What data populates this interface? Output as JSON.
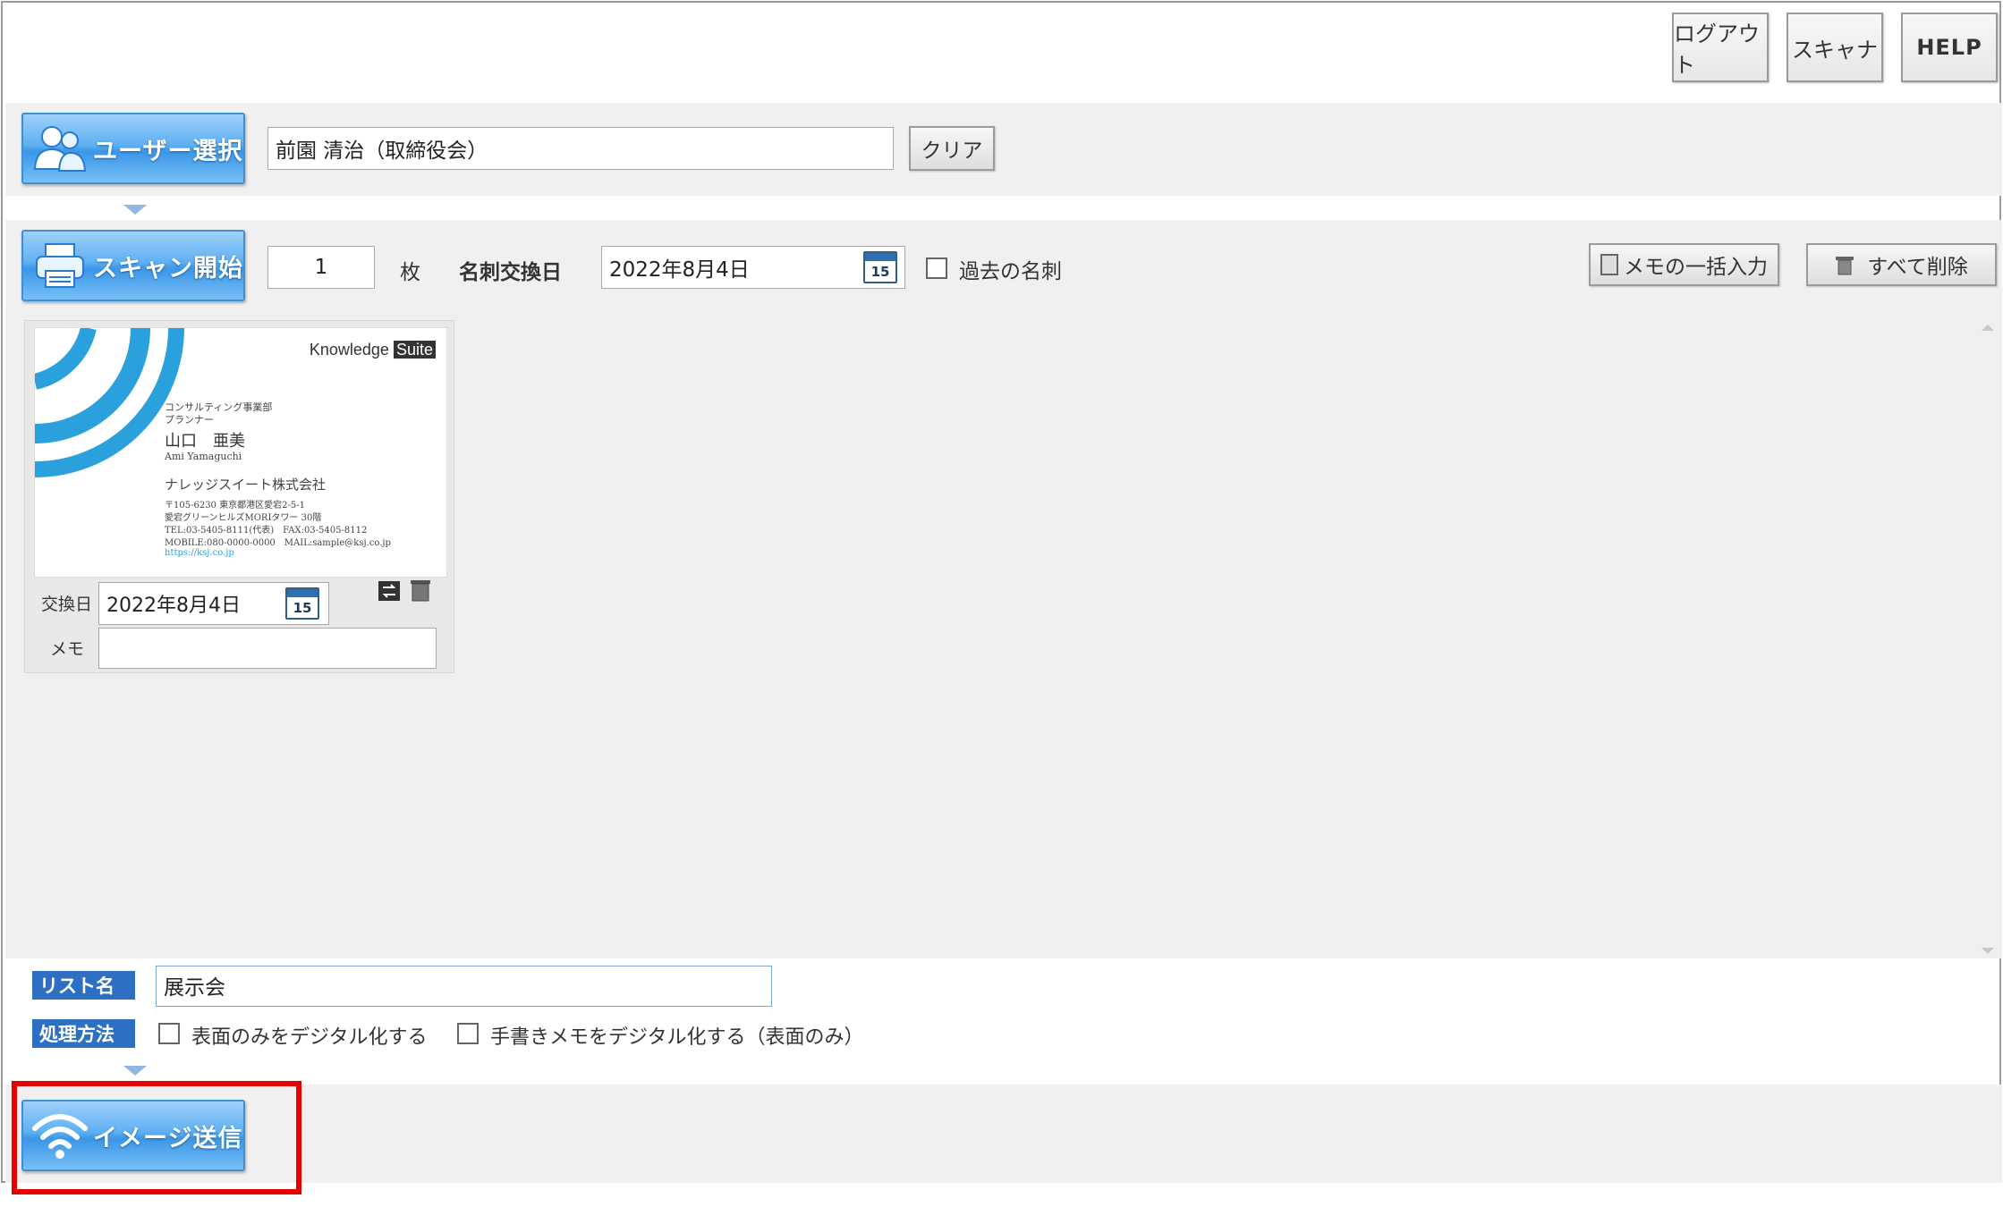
{
  "header": {
    "logout_label": "ログアウト",
    "scanner_label": "スキャナ",
    "help_label": "HELP"
  },
  "user_section": {
    "select_button_label": "ユーザー選択",
    "selected_user": "前園 清治（取締役会）",
    "clear_label": "クリア"
  },
  "scan_section": {
    "scan_button_label": "スキャン開始",
    "count_value": "1",
    "count_unit": "枚",
    "exchange_date_label": "名刺交換日",
    "exchange_date_value": "2022年8月4日",
    "calendar_day": "15",
    "past_card_label": "過去の名刺",
    "memo_bulk_label": "メモの一括入力",
    "delete_all_label": "すべて削除"
  },
  "card": {
    "brand": "Knowledge",
    "brand_suffix": "Suite",
    "dept": "コンサルティング事業部",
    "role": "プランナー",
    "name": "山口　亜美",
    "name_roman": "Ami Yamaguchi",
    "company": "ナレッジスイート株式会社",
    "addr1": "〒105-6230 東京都港区愛宕2-5-1",
    "addr2": "愛宕グリーンヒルズMORIタワー 30階",
    "tel": "TEL:03-5405-8111(代表)　FAX:03-5405-8112",
    "mobile": "MOBILE:080-0000-0000　MAIL:sample@ksj.co.jp",
    "url": "https://ksj.co.jp",
    "exchange_label": "交換日",
    "exchange_value": "2022年8月4日",
    "calendar_day": "15",
    "memo_label": "メモ",
    "memo_value": ""
  },
  "bottom": {
    "list_name_tag": "リスト名",
    "list_name_value": "展示会",
    "method_tag": "処理方法",
    "option_front_only": "表面のみをデジタル化する",
    "option_handwritten": "手書きメモをデジタル化する（表面のみ）",
    "send_button_label": "イメージ送信"
  },
  "colors": {
    "accent_blue": "#3b96e6",
    "tag_blue": "#2d6fc2",
    "highlight_red": "#e60000"
  }
}
